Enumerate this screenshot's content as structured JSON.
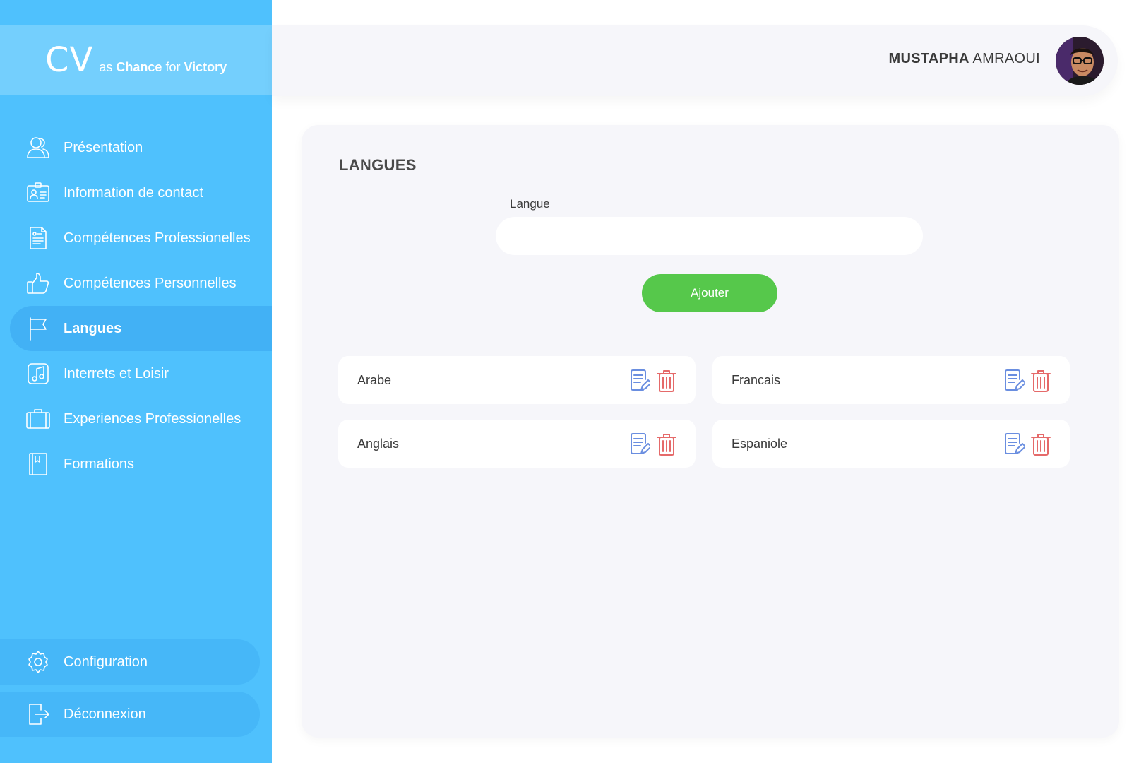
{
  "brand": {
    "logo": "CV",
    "tagline_as": "as",
    "tagline_chance": "Chance",
    "tagline_for": "for",
    "tagline_victory": "Victory"
  },
  "sidebar": {
    "items": [
      {
        "label": "Présentation",
        "icon": "users-icon"
      },
      {
        "label": "Information de contact",
        "icon": "id-card-icon"
      },
      {
        "label": "Compétences Professionelles",
        "icon": "document-icon"
      },
      {
        "label": "Compétences Personnelles",
        "icon": "thumbs-up-icon"
      },
      {
        "label": "Langues",
        "icon": "flag-icon",
        "active": true
      },
      {
        "label": "Interrets et Loisir",
        "icon": "music-note-icon"
      },
      {
        "label": "Experiences Professionelles",
        "icon": "briefcase-icon"
      },
      {
        "label": "Formations",
        "icon": "book-icon"
      }
    ],
    "bottom": [
      {
        "label": "Configuration",
        "icon": "gear-icon"
      },
      {
        "label": "Déconnexion",
        "icon": "logout-icon"
      }
    ]
  },
  "header": {
    "user_first": "MUSTAPHA",
    "user_last": "AMRAOUI",
    "avatar_icon": "user-avatar"
  },
  "main": {
    "title": "LANGUES",
    "field_label": "Langue",
    "input_value": "",
    "add_label": "Ajouter",
    "languages": [
      {
        "label": "Arabe"
      },
      {
        "label": "Francais"
      },
      {
        "label": "Anglais"
      },
      {
        "label": "Espaniole"
      }
    ]
  },
  "colors": {
    "sidebar": "#4fc1fd",
    "brand_bar": "#74cffd",
    "active_item": "#42b1f5",
    "add_button": "#56c84b",
    "edit_icon": "#6a8ee0",
    "delete_icon": "#e56a6a",
    "panel": "#f6f6fa"
  }
}
